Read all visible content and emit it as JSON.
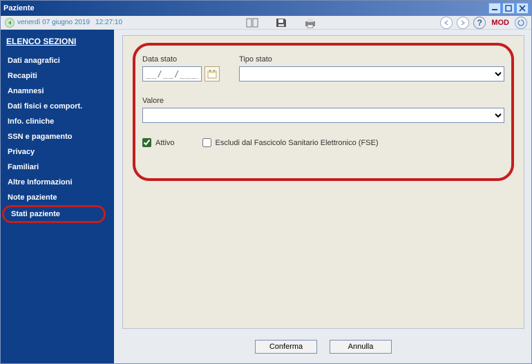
{
  "window": {
    "title": "Paziente"
  },
  "status": {
    "date": "venerdì 07 giugno 2019",
    "time": "12:27:10",
    "mod": "MOD"
  },
  "sidebar": {
    "title": "ELENCO SEZIONI",
    "items": [
      {
        "label": "Dati anagrafici"
      },
      {
        "label": "Recapiti"
      },
      {
        "label": "Anamnesi"
      },
      {
        "label": "Dati fisici e comport."
      },
      {
        "label": "Info. cliniche"
      },
      {
        "label": "SSN e pagamento"
      },
      {
        "label": "Privacy"
      },
      {
        "label": "Familiari"
      },
      {
        "label": "Altre Informazioni"
      },
      {
        "label": "Note paziente"
      },
      {
        "label": "Stati paziente"
      }
    ]
  },
  "form": {
    "data_stato_label": "Data stato",
    "data_stato_placeholder": "__/__/____",
    "tipo_stato_label": "Tipo stato",
    "tipo_stato_value": "",
    "valore_label": "Valore",
    "valore_value": "",
    "attivo_label": "Attivo",
    "attivo_checked": true,
    "fse_label": "Escludi dal Fascicolo Sanitario Elettronico (FSE)",
    "fse_checked": false
  },
  "buttons": {
    "confirm": "Conferma",
    "cancel": "Annulla"
  }
}
